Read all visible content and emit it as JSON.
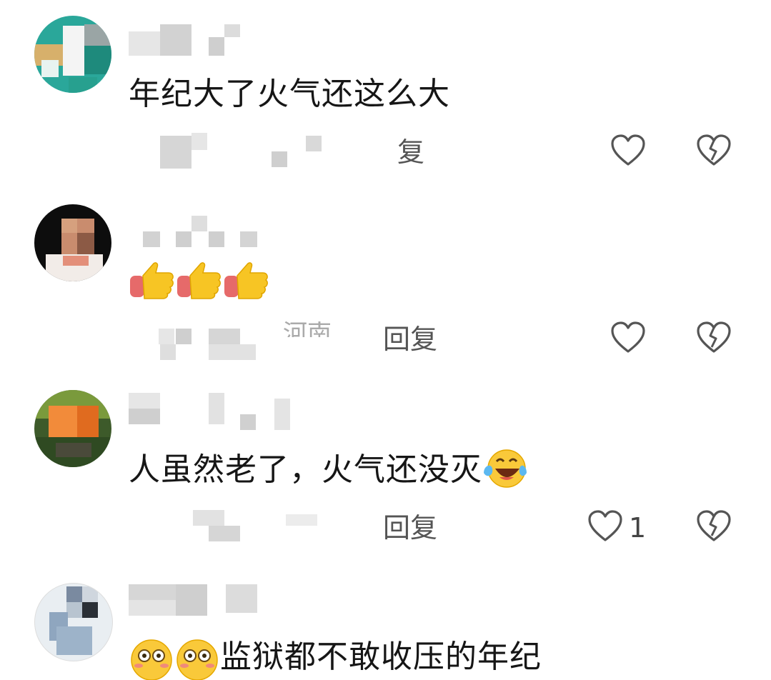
{
  "comments": [
    {
      "text": "年纪大了火气还这么大",
      "reply_label": "复",
      "like_count": ""
    },
    {
      "text": "",
      "reply_label": "回复",
      "location": "河南",
      "like_count": ""
    },
    {
      "text": "人虽然老了，火气还没灭",
      "reply_label": "回复",
      "like_count": "1"
    },
    {
      "text": "监狱都不敢收压的年纪",
      "reply_label": "",
      "like_count": ""
    }
  ],
  "icons": {
    "like": "heart-outline-icon",
    "dislike": "broken-heart-icon",
    "thumbs_up": "thumbs-up-emoji",
    "laugh_cry": "laughing-crying-emoji",
    "smile": "smiling-face-emoji"
  }
}
